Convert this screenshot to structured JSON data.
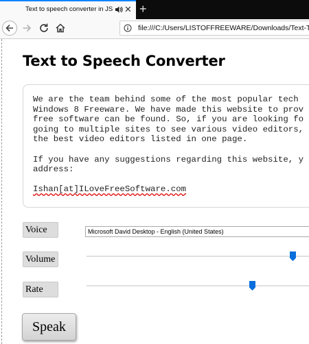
{
  "browser": {
    "tab_title": "Text to speech converter in JS",
    "tab_close": "✕",
    "new_tab": "+",
    "url": "file:///C:/Users/LISTOFFREEWARE/Downloads/Text-To-S"
  },
  "page": {
    "title": "Text to Speech Converter",
    "text_lines": [
      "We are the team behind some of the most popular tech",
      "Windows 8 Freeware. We have made this website to prov",
      "free software can be found. So, if you are looking fo",
      "going to multiple sites to see various video editors,",
      "the best video editors listed in one page.",
      "",
      "If you have any suggestions regarding this website, y",
      "address:",
      ""
    ],
    "email": "Ishan[at]ILoveFreeSoftware.com",
    "voice_label": "Voice",
    "voice_value": "Microsoft David Desktop - English (United States)",
    "volume_label": "Volume",
    "volume_level": 0.885,
    "rate_label": "Rate",
    "rate_level": 0.71,
    "speak_label": "Speak"
  },
  "colors": {
    "accent": "#0a84ff",
    "slider_thumb": "#0a6fdc"
  }
}
